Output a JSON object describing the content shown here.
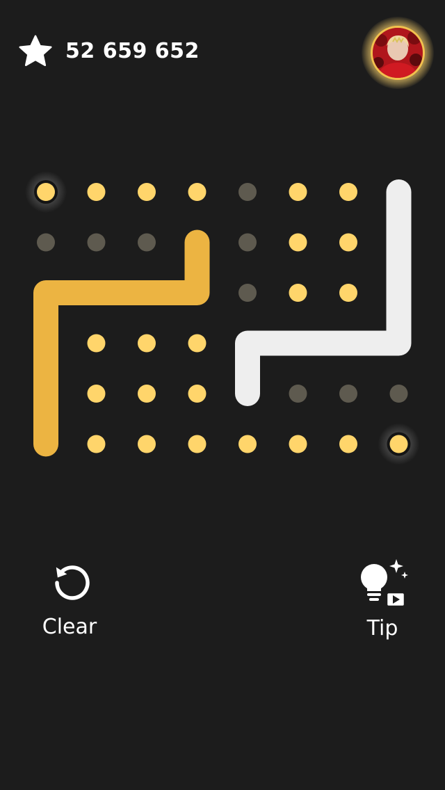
{
  "header": {
    "score": "52 659 652",
    "star_icon": "star-icon",
    "avatar_icon": "profile-avatar"
  },
  "board": {
    "cols": 8,
    "rows": 6,
    "colors": {
      "dot_active": "#ffd56b",
      "dot_inactive": "#5e5a4f",
      "path_gold": "#ecb442",
      "path_white": "#eeeeee",
      "endpoint_ring": "#141414"
    },
    "inactive_dots": [
      [
        0,
        4
      ],
      [
        1,
        0
      ],
      [
        1,
        1
      ],
      [
        1,
        2
      ],
      [
        1,
        4
      ],
      [
        2,
        4
      ],
      [
        4,
        5
      ],
      [
        4,
        6
      ],
      [
        4,
        7
      ]
    ],
    "empty_cells": [
      [
        0,
        7
      ],
      [
        1,
        3
      ],
      [
        1,
        7
      ],
      [
        2,
        0
      ],
      [
        2,
        1
      ],
      [
        2,
        2
      ],
      [
        2,
        3
      ],
      [
        2,
        7
      ],
      [
        3,
        0
      ],
      [
        3,
        4
      ],
      [
        3,
        5
      ],
      [
        3,
        6
      ],
      [
        3,
        7
      ],
      [
        4,
        0
      ],
      [
        4,
        4
      ],
      [
        5,
        0
      ]
    ],
    "endpoints": [
      [
        0,
        0
      ],
      [
        5,
        0
      ],
      [
        5,
        7
      ]
    ],
    "paths": [
      {
        "color": "gold",
        "cells": [
          [
            5,
            0
          ],
          [
            2,
            0
          ],
          [
            2,
            3
          ],
          [
            1,
            3
          ]
        ]
      },
      {
        "color": "white",
        "cells": [
          [
            0,
            7
          ],
          [
            3,
            7
          ],
          [
            3,
            4
          ],
          [
            4,
            4
          ]
        ]
      }
    ]
  },
  "actions": {
    "clear_label": "Clear",
    "tip_label": "Tip"
  }
}
